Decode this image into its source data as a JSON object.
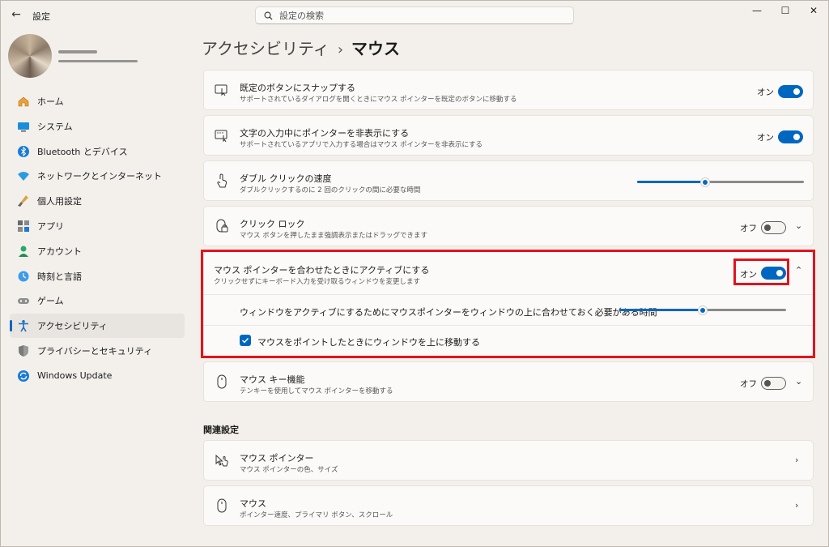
{
  "app": {
    "title": "設定"
  },
  "search": {
    "placeholder": "設定の検索"
  },
  "window_controls": {
    "minimize": "—",
    "maximize": "☐",
    "close": "✕"
  },
  "nav": {
    "items": [
      {
        "label": "ホーム",
        "icon": "home-icon"
      },
      {
        "label": "システム",
        "icon": "system-icon"
      },
      {
        "label": "Bluetooth とデバイス",
        "icon": "bluetooth-icon"
      },
      {
        "label": "ネットワークとインターネット",
        "icon": "wifi-icon"
      },
      {
        "label": "個人用設定",
        "icon": "brush-icon"
      },
      {
        "label": "アプリ",
        "icon": "apps-icon"
      },
      {
        "label": "アカウント",
        "icon": "account-icon"
      },
      {
        "label": "時刻と言語",
        "icon": "clock-globe-icon"
      },
      {
        "label": "ゲーム",
        "icon": "gamepad-icon"
      },
      {
        "label": "アクセシビリティ",
        "icon": "accessibility-icon",
        "active": true
      },
      {
        "label": "プライバシーとセキュリティ",
        "icon": "shield-icon"
      },
      {
        "label": "Windows Update",
        "icon": "update-icon"
      }
    ]
  },
  "breadcrumb": {
    "parent": "アクセシビリティ",
    "separator": "›",
    "current": "マウス"
  },
  "settings": {
    "snap": {
      "title": "既定のボタンにスナップする",
      "subtitle": "サポートされているダイアログを開くときにマウス ポインターを既定のボタンに移動する",
      "state": "オン",
      "on": true
    },
    "hide_pointer": {
      "title": "文字の入力中にポインターを非表示にする",
      "subtitle": "サポートされているアプリで入力する場合はマウス ポインターを非表示にする",
      "state": "オン",
      "on": true
    },
    "double_click": {
      "title": "ダブル クリックの速度",
      "subtitle": "ダブルクリックするのに 2 回のクリックの間に必要な時間",
      "slider_value": 0.41
    },
    "click_lock": {
      "title": "クリック ロック",
      "subtitle": "マウス ボタンを押したまま強調表示またはドラッグできます",
      "state": "オフ",
      "on": false
    },
    "activate_hover": {
      "title": "マウス ポインターを合わせたときにアクティブにする",
      "subtitle": "クリックせずにキーボード入力を受け取るウィンドウを変更します",
      "state": "オン",
      "on": true,
      "delay_label": "ウィンドウをアクティブにするためにマウスポインターをウィンドウの上に合わせておく必要がある時間",
      "delay_slider_value": 0.5,
      "raise_label": "マウスをポイントしたときにウィンドウを上に移動する",
      "raise_checked": true
    },
    "mouse_keys": {
      "title": "マウス キー機能",
      "subtitle": "テンキーを使用してマウス ポインターを移動する",
      "state": "オフ",
      "on": false
    }
  },
  "related": {
    "heading": "関連設定",
    "items": [
      {
        "title": "マウス ポインター",
        "subtitle": "マウス ポインターの色、サイズ"
      },
      {
        "title": "マウス",
        "subtitle": "ポインター速度、プライマリ ボタン、スクロール"
      }
    ]
  },
  "colors": {
    "accent": "#0067c0",
    "highlight": "#e0141e"
  }
}
